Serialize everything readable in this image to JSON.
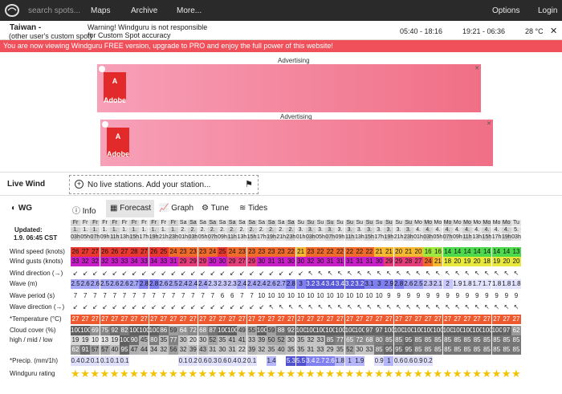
{
  "topbar": {
    "search_placeholder": "search spots...",
    "nav": [
      "Maps",
      "Archive",
      "More...",
      "Options",
      "Login"
    ]
  },
  "spot": {
    "name": "Taiwan - ",
    "extra": "(other user's custom spot)",
    "warning1": "Warning! Windguru is not responsible",
    "warning2": "for Custom Spot accuracy",
    "sun": "05:40 - 18:16",
    "moon": "19:21 - 06:36",
    "temp": "28 °C"
  },
  "promo": "You are now viewing Windguru FREE version, upgrade to PRO and enjoy the full power of this website!",
  "ads": [
    {
      "label": "Advertising",
      "brand": "Adobe"
    },
    {
      "label": "Advertising",
      "brand": "Adobe"
    }
  ],
  "livewind": {
    "label": "Live Wind",
    "text": "No live stations. Add your station..."
  },
  "tabs": [
    "WG",
    "Info",
    "Forecast",
    "Graph",
    "Tune",
    "Tides"
  ],
  "updated": {
    "label": "Updated:",
    "value": "1.9. 06:45 CST"
  },
  "forecast": {
    "days": [
      "Fr",
      "Fr",
      "Fr",
      "Fr",
      "Fr",
      "Fr",
      "Fr",
      "Fr",
      "Fr",
      "Fr",
      "Fr",
      "Sa",
      "Sa",
      "Sa",
      "Sa",
      "Sa",
      "Sa",
      "Sa",
      "Sa",
      "Sa",
      "Sa",
      "Sa",
      "Sa",
      "Su",
      "Su",
      "Su",
      "Su",
      "Su",
      "Su",
      "Su",
      "Su",
      "Su",
      "Su",
      "Su",
      "Su",
      "Mo",
      "Mo",
      "Mo",
      "Mo",
      "Mo",
      "Mo",
      "Mo",
      "Mo",
      "Mo",
      "Mo",
      "Tu"
    ],
    "dates": [
      "1.",
      "1.",
      "1.",
      "1.",
      "1.",
      "1.",
      "1.",
      "1.",
      "1.",
      "1.",
      "1.",
      "2.",
      "2.",
      "2.",
      "2.",
      "2.",
      "2.",
      "2.",
      "2.",
      "2.",
      "2.",
      "2.",
      "2.",
      "3.",
      "3.",
      "3.",
      "3.",
      "3.",
      "3.",
      "3.",
      "3.",
      "3.",
      "3.",
      "3.",
      "3.",
      "4.",
      "4.",
      "4.",
      "4.",
      "4.",
      "4.",
      "4.",
      "4.",
      "4.",
      "4.",
      "5."
    ],
    "hours": [
      "03h",
      "05h",
      "07h",
      "09h",
      "11h",
      "13h",
      "15h",
      "17h",
      "19h",
      "21h",
      "23h",
      "01h",
      "03h",
      "05h",
      "07h",
      "09h",
      "11h",
      "13h",
      "15h",
      "17h",
      "19h",
      "21h",
      "23h",
      "01h",
      "03h",
      "05h",
      "07h",
      "09h",
      "11h",
      "13h",
      "15h",
      "17h",
      "19h",
      "21h",
      "23h",
      "01h",
      "03h",
      "05h",
      "07h",
      "09h",
      "11h",
      "13h",
      "15h",
      "17h",
      "19h",
      "03h"
    ],
    "rows": [
      {
        "label": "Wind speed (knots)",
        "values": [
          "26",
          "27",
          "27",
          "26",
          "26",
          "27",
          "28",
          "27",
          "26",
          "25",
          "24",
          "23",
          "23",
          "23",
          "24",
          "25",
          "24",
          "23",
          "23",
          "23",
          "23",
          "23",
          "22",
          "21",
          "23",
          "22",
          "22",
          "22",
          "22",
          "22",
          "22",
          "21",
          "21",
          "20",
          "21",
          "20",
          "16",
          "16",
          "14",
          "14",
          "14",
          "14",
          "14",
          "14",
          "14",
          "13"
        ]
      },
      {
        "label": "Wind gusts (knots)",
        "values": [
          "33",
          "32",
          "32",
          "32",
          "33",
          "33",
          "34",
          "33",
          "34",
          "33",
          "31",
          "29",
          "29",
          "29",
          "30",
          "30",
          "29",
          "27",
          "29",
          "30",
          "31",
          "31",
          "30",
          "30",
          "32",
          "30",
          "31",
          "31",
          "31",
          "31",
          "31",
          "30",
          "29",
          "29",
          "28",
          "27",
          "24",
          "21",
          "18",
          "20",
          "19",
          "20",
          "18",
          "19",
          "20",
          "20"
        ]
      },
      {
        "label": "Wind direction (→)",
        "values": []
      },
      {
        "label": "Wave (m)",
        "values": [
          "2.5",
          "2.6",
          "2.6",
          "2.5",
          "2.6",
          "2.6",
          "2.7",
          "2.8",
          "2.8",
          "2.6",
          "2.5",
          "2.4",
          "2.4",
          "2.4",
          "2.3",
          "2.3",
          "2.3",
          "2.4",
          "2.4",
          "2.4",
          "2.6",
          "2.7",
          "2.8",
          "3",
          "3.2",
          "3.4",
          "3.4",
          "3.4",
          "3.2",
          "3.2",
          "3.1",
          "3",
          "2.9",
          "2.8",
          "2.6",
          "2.5",
          "2.3",
          "2.1",
          "2",
          "1.9",
          "1.8",
          "1.7",
          "1.7",
          "1.8",
          "1.8",
          "1.8"
        ]
      },
      {
        "label": "Wave period (s)",
        "values": [
          "7",
          "7",
          "7",
          "7",
          "7",
          "7",
          "7",
          "7",
          "7",
          "7",
          "7",
          "7",
          "7",
          "7",
          "7",
          "6",
          "6",
          "7",
          "7",
          "10",
          "10",
          "10",
          "10",
          "10",
          "10",
          "10",
          "10",
          "10",
          "10",
          "10",
          "10",
          "10",
          "9",
          "9",
          "9",
          "9",
          "9",
          "9",
          "9",
          "9",
          "9",
          "9",
          "9",
          "9",
          "9",
          "9"
        ]
      },
      {
        "label": "Wave direction (→)",
        "values": []
      },
      {
        "label": "*Temperature (°C)",
        "values": [
          "27",
          "27",
          "27",
          "27",
          "27",
          "27",
          "27",
          "27",
          "27",
          "27",
          "27",
          "27",
          "27",
          "27",
          "27",
          "27",
          "27",
          "27",
          "27",
          "27",
          "27",
          "27",
          "27",
          "27",
          "27",
          "27",
          "27",
          "27",
          "27",
          "27",
          "27",
          "27",
          "27",
          "27",
          "27",
          "27",
          "27",
          "27",
          "27",
          "27",
          "27",
          "27",
          "27",
          "27",
          "27",
          "27"
        ]
      },
      {
        "label": "Cloud cover (%)",
        "values": [
          "100",
          "100",
          "69",
          "75",
          "92",
          "82",
          "100",
          "100",
          "100",
          "86",
          "59",
          "64",
          "72",
          "68",
          "87",
          "100",
          "100",
          "49",
          "55",
          "100",
          "59",
          "88",
          "92",
          "100",
          "100",
          "100",
          "100",
          "100",
          "100",
          "100",
          "97",
          "97",
          "100",
          "100",
          "100",
          "100",
          "100",
          "100",
          "100",
          "100",
          "100",
          "100",
          "100",
          "100",
          "97",
          "62"
        ]
      },
      {
        "label": "high / mid / low",
        "values": [
          "19",
          "19",
          "10",
          "13",
          "19",
          "100",
          "90",
          "45",
          "80",
          "35",
          "77",
          "30",
          "20",
          "30",
          "52",
          "35",
          "41",
          "41",
          "33",
          "39",
          "50",
          "52",
          "30",
          "35",
          "32",
          "33",
          "85",
          "77",
          "65",
          "72",
          "68",
          "80",
          "85",
          "85",
          "95",
          "85",
          "85",
          "85",
          "85",
          "85",
          "85",
          "85",
          "85",
          "85",
          "85",
          "85"
        ]
      },
      {
        "label": "",
        "values": [
          "62",
          "91",
          "57",
          "57",
          "40",
          "95",
          "47",
          "44",
          "34",
          "32",
          "56",
          "32",
          "39",
          "43",
          "31",
          "30",
          "31",
          "22",
          "39",
          "32",
          "35",
          "40",
          "35",
          "35",
          "31",
          "33",
          "29",
          "35",
          "52",
          "30",
          "33",
          "85",
          "95",
          "95",
          "95",
          "85",
          "85",
          "85",
          "85",
          "85",
          "85",
          "85",
          "85",
          "85",
          "85",
          "85"
        ]
      },
      {
        "label": "*Precip. (mm/1h)",
        "values": [
          "0.4",
          "0.2",
          "0.1",
          "0.1",
          "0.1",
          "0.1",
          "",
          "",
          "",
          "",
          "",
          "0.1",
          "0.2",
          "0.6",
          "0.3",
          "0.6",
          "0.4",
          "0.2",
          "0.1",
          "",
          "1.4",
          "",
          "5.3",
          "5.5",
          "3.4",
          "2.7",
          "2.6",
          "1.8",
          "1",
          "1.9",
          "",
          "0.9",
          "1",
          "0.6",
          "0.6",
          "0.9",
          "0.2",
          "",
          "",
          "",
          "",
          "",
          "",
          "",
          "",
          ""
        ]
      },
      {
        "label": "Windguru rating",
        "values": []
      }
    ]
  },
  "colors": {
    "topbar": "#2a2a2a",
    "promo": "#f0505a",
    "star": "#f2c200"
  }
}
